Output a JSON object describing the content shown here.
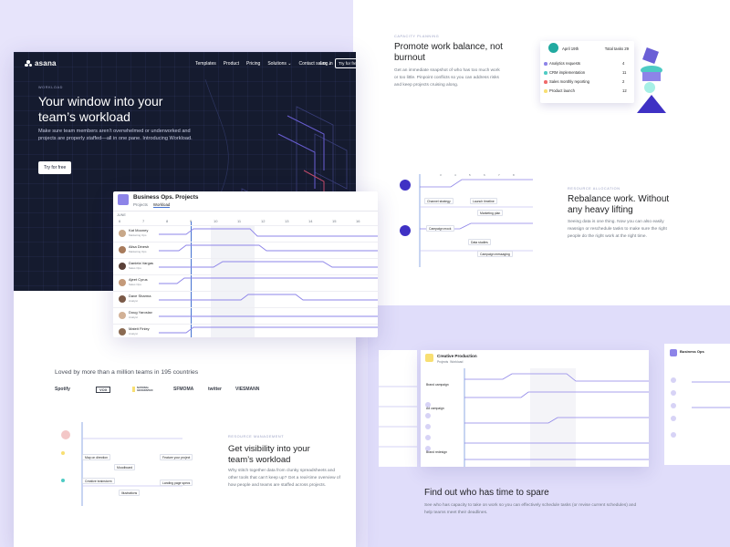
{
  "hero": {
    "nav": {
      "logo": "asana",
      "links": [
        "Templates",
        "Product",
        "Pricing",
        "Solutions ⌄",
        "Contact sales ⌄"
      ],
      "login": "Log in",
      "try": "Try for free"
    },
    "eyebrow": "WORKLOAD",
    "title": "Your window into your team’s workload",
    "body": "Make sure team members aren’t overwhelmed or underworked and projects are properly staffed—all in one pane. Introducing Workload.",
    "cta": "Try for free"
  },
  "workload_card": {
    "title": "Business Ops. Projects",
    "tabs": [
      "Projects",
      "Workload"
    ],
    "month": "JUNE",
    "days": [
      "6",
      "7",
      "8",
      "9",
      "10",
      "11",
      "12",
      "13",
      "14",
      "15",
      "16"
    ],
    "people": [
      {
        "name": "Kat Mooney",
        "role": "Marketing Ops"
      },
      {
        "name": "Alisa Dinesh",
        "role": "Marketing Ops"
      },
      {
        "name": "Daniela Vargas",
        "role": "Sales Ops"
      },
      {
        "name": "Ajeet Cyrus",
        "role": "Sales Ops"
      },
      {
        "name": "Dave Sharma",
        "role": "Analyst"
      },
      {
        "name": "Doug Yaroslav",
        "role": "Analyst"
      },
      {
        "name": "Mateit Finley",
        "role": "Analyst"
      }
    ]
  },
  "loved": {
    "text": "Loved by more than a million teams in 195 countries",
    "brands": [
      "Spotify",
      "VOX",
      "NATIONAL GEOGRAPHIC",
      "SFMOMA",
      "twitter",
      "VIESMANN"
    ]
  },
  "resource_management": {
    "eyebrow": "RESOURCE MANAGEMENT",
    "title": "Get visibility into your team’s workload",
    "body": "Why stitch together data from clunky spreadsheets and other tools that can’t keep up? Get a real-time overview of how people and teams are staffed across projects.",
    "tasks": [
      "Map on direction",
      "Feature your project",
      "Moodboard",
      "Creative brainstorm",
      "Landing page specs",
      "Illustrations"
    ]
  },
  "capacity_planning": {
    "eyebrow": "CAPACITY PLANNING",
    "title": "Promote work balance, not burnout",
    "body": "Get an immediate snapshot of who has too much work or too little. Pinpoint conflicts so you can address risks and keep projects cruising along.",
    "card": {
      "date": "April 19th",
      "total_label": "Total tasks 29",
      "items": [
        {
          "label": "Analytics requests",
          "count": "4",
          "color": "#8d84e8"
        },
        {
          "label": "CRM implementation",
          "count": "11",
          "color": "#4ecbc4"
        },
        {
          "label": "Sales monthly reporting",
          "count": "2",
          "color": "#f06a6a"
        },
        {
          "label": "Product launch",
          "count": "12",
          "color": "#f8df72"
        }
      ]
    }
  },
  "resource_allocation": {
    "eyebrow": "RESOURCE ALLOCATION",
    "title": "Rebalance work. Without any heavy lifting",
    "body": "Seeing data is one thing. Now you can also easily reassign or reschedule tasks to make sure the right people do the right work at the right time.",
    "tasks": [
      "Channel strategy",
      "Launch timeline",
      "Marketing plan",
      "Campaign mock",
      "Data studies",
      "Campaign messaging"
    ]
  },
  "time_to_spare": {
    "card_title": "Creative Production",
    "card_tabs": [
      "Projects",
      "Workload"
    ],
    "side_card_title": "Business Ops",
    "title": "Find out who has time to spare",
    "body": "See who has capacity to take on work so you can effectively schedule tasks (or revise current schedules) and help teams meet their deadlines.",
    "rows": [
      "Brand campaign",
      "Ad campaign",
      "Brand redesign",
      "Website redesign"
    ]
  }
}
